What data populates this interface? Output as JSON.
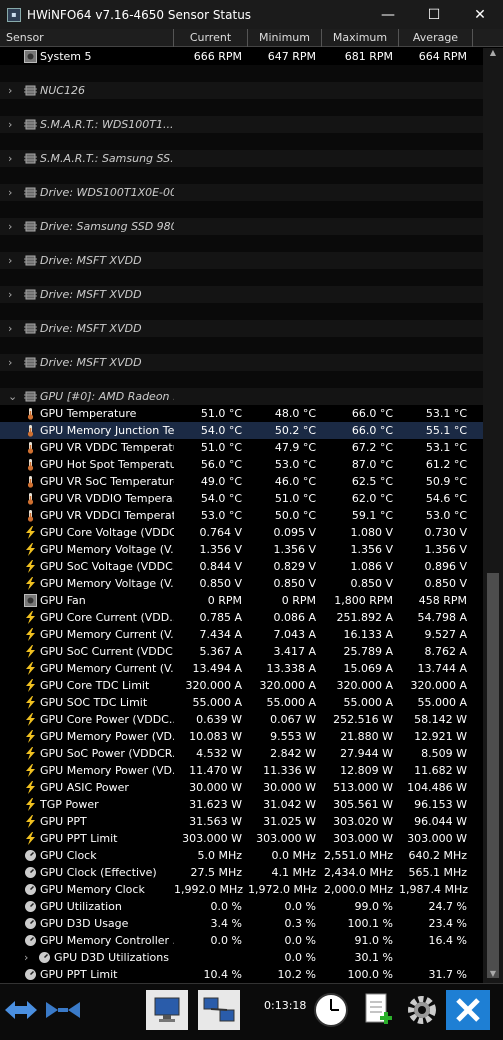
{
  "window": {
    "title": "HWiNFO64 v7.16-4650 Sensor Status",
    "min": "—",
    "max": "☐",
    "close": "✕"
  },
  "columns": [
    "Sensor",
    "Current",
    "Minimum",
    "Maximum",
    "Average"
  ],
  "rows": [
    {
      "type": "sensor",
      "icon": "fan",
      "name": "System 5",
      "cur": "666 RPM",
      "min": "647 RPM",
      "max": "681 RPM",
      "avg": "664 RPM"
    },
    {
      "type": "spacer"
    },
    {
      "type": "group",
      "name": "NUC126"
    },
    {
      "type": "spacer"
    },
    {
      "type": "group",
      "name": "S.M.A.R.T.: WDS100T1..."
    },
    {
      "type": "spacer"
    },
    {
      "type": "group",
      "name": "S.M.A.R.T.: Samsung SS..."
    },
    {
      "type": "spacer"
    },
    {
      "type": "group",
      "name": "Drive: WDS100T1X0E-00..."
    },
    {
      "type": "spacer"
    },
    {
      "type": "group",
      "name": "Drive: Samsung SSD 980..."
    },
    {
      "type": "spacer"
    },
    {
      "type": "group",
      "name": "Drive: MSFT XVDD"
    },
    {
      "type": "spacer"
    },
    {
      "type": "group",
      "name": "Drive: MSFT XVDD"
    },
    {
      "type": "spacer"
    },
    {
      "type": "group",
      "name": "Drive: MSFT XVDD"
    },
    {
      "type": "spacer"
    },
    {
      "type": "group",
      "name": "Drive: MSFT XVDD"
    },
    {
      "type": "spacer"
    },
    {
      "type": "group",
      "name": "GPU [#0]: AMD Radeon ...",
      "open": true
    },
    {
      "type": "sensor",
      "icon": "temp",
      "name": "GPU Temperature",
      "cur": "51.0 °C",
      "min": "48.0 °C",
      "max": "66.0 °C",
      "avg": "53.1 °C"
    },
    {
      "type": "sensor",
      "icon": "temp",
      "name": "GPU Memory Junction Te...",
      "cur": "54.0 °C",
      "min": "50.2 °C",
      "max": "66.0 °C",
      "avg": "55.1 °C",
      "selected": true
    },
    {
      "type": "sensor",
      "icon": "temp",
      "name": "GPU VR VDDC Temperature",
      "cur": "51.0 °C",
      "min": "47.9 °C",
      "max": "67.2 °C",
      "avg": "53.1 °C"
    },
    {
      "type": "sensor",
      "icon": "temp",
      "name": "GPU Hot Spot Temperature",
      "cur": "56.0 °C",
      "min": "53.0 °C",
      "max": "87.0 °C",
      "avg": "61.2 °C"
    },
    {
      "type": "sensor",
      "icon": "temp",
      "name": "GPU VR SoC Temperature",
      "cur": "49.0 °C",
      "min": "46.0 °C",
      "max": "62.5 °C",
      "avg": "50.9 °C"
    },
    {
      "type": "sensor",
      "icon": "temp",
      "name": "GPU VR VDDIO Tempera...",
      "cur": "54.0 °C",
      "min": "51.0 °C",
      "max": "62.0 °C",
      "avg": "54.6 °C"
    },
    {
      "type": "sensor",
      "icon": "temp",
      "name": "GPU VR VDDCI Temperat...",
      "cur": "53.0 °C",
      "min": "50.0 °C",
      "max": "59.1 °C",
      "avg": "53.0 °C"
    },
    {
      "type": "sensor",
      "icon": "bolt",
      "name": "GPU Core Voltage (VDDC...",
      "cur": "0.764 V",
      "min": "0.095 V",
      "max": "1.080 V",
      "avg": "0.730 V"
    },
    {
      "type": "sensor",
      "icon": "bolt",
      "name": "GPU Memory Voltage (V...",
      "cur": "1.356 V",
      "min": "1.356 V",
      "max": "1.356 V",
      "avg": "1.356 V"
    },
    {
      "type": "sensor",
      "icon": "bolt",
      "name": "GPU SoC Voltage (VDDC...",
      "cur": "0.844 V",
      "min": "0.829 V",
      "max": "1.086 V",
      "avg": "0.896 V"
    },
    {
      "type": "sensor",
      "icon": "bolt",
      "name": "GPU Memory Voltage (V...",
      "cur": "0.850 V",
      "min": "0.850 V",
      "max": "0.850 V",
      "avg": "0.850 V"
    },
    {
      "type": "sensor",
      "icon": "fan",
      "name": "GPU Fan",
      "cur": "0 RPM",
      "min": "0 RPM",
      "max": "1,800 RPM",
      "avg": "458 RPM"
    },
    {
      "type": "sensor",
      "icon": "bolt",
      "name": "GPU Core Current (VDD...",
      "cur": "0.785 A",
      "min": "0.086 A",
      "max": "251.892 A",
      "avg": "54.798 A"
    },
    {
      "type": "sensor",
      "icon": "bolt",
      "name": "GPU Memory Current (V...",
      "cur": "7.434 A",
      "min": "7.043 A",
      "max": "16.133 A",
      "avg": "9.527 A"
    },
    {
      "type": "sensor",
      "icon": "bolt",
      "name": "GPU SoC Current (VDDC...",
      "cur": "5.367 A",
      "min": "3.417 A",
      "max": "25.789 A",
      "avg": "8.762 A"
    },
    {
      "type": "sensor",
      "icon": "bolt",
      "name": "GPU Memory Current (V...",
      "cur": "13.494 A",
      "min": "13.338 A",
      "max": "15.069 A",
      "avg": "13.744 A"
    },
    {
      "type": "sensor",
      "icon": "bolt",
      "name": "GPU Core TDC Limit",
      "cur": "320.000 A",
      "min": "320.000 A",
      "max": "320.000 A",
      "avg": "320.000 A"
    },
    {
      "type": "sensor",
      "icon": "bolt",
      "name": "GPU SOC TDC Limit",
      "cur": "55.000 A",
      "min": "55.000 A",
      "max": "55.000 A",
      "avg": "55.000 A"
    },
    {
      "type": "sensor",
      "icon": "bolt",
      "name": "GPU Core Power (VDDC...",
      "cur": "0.639 W",
      "min": "0.067 W",
      "max": "252.516 W",
      "avg": "58.142 W"
    },
    {
      "type": "sensor",
      "icon": "bolt",
      "name": "GPU Memory Power (VD...",
      "cur": "10.083 W",
      "min": "9.553 W",
      "max": "21.880 W",
      "avg": "12.921 W"
    },
    {
      "type": "sensor",
      "icon": "bolt",
      "name": "GPU SoC Power (VDDCR...",
      "cur": "4.532 W",
      "min": "2.842 W",
      "max": "27.944 W",
      "avg": "8.509 W"
    },
    {
      "type": "sensor",
      "icon": "bolt",
      "name": "GPU Memory Power (VD...",
      "cur": "11.470 W",
      "min": "11.336 W",
      "max": "12.809 W",
      "avg": "11.682 W"
    },
    {
      "type": "sensor",
      "icon": "bolt",
      "name": "GPU ASIC Power",
      "cur": "30.000 W",
      "min": "30.000 W",
      "max": "513.000 W",
      "avg": "104.486 W"
    },
    {
      "type": "sensor",
      "icon": "bolt",
      "name": "TGP Power",
      "cur": "31.623 W",
      "min": "31.042 W",
      "max": "305.561 W",
      "avg": "96.153 W"
    },
    {
      "type": "sensor",
      "icon": "bolt",
      "name": "GPU PPT",
      "cur": "31.563 W",
      "min": "31.025 W",
      "max": "303.020 W",
      "avg": "96.044 W"
    },
    {
      "type": "sensor",
      "icon": "bolt",
      "name": "GPU PPT Limit",
      "cur": "303.000 W",
      "min": "303.000 W",
      "max": "303.000 W",
      "avg": "303.000 W"
    },
    {
      "type": "sensor",
      "icon": "gauge",
      "name": "GPU Clock",
      "cur": "5.0 MHz",
      "min": "0.0 MHz",
      "max": "2,551.0 MHz",
      "avg": "640.2 MHz"
    },
    {
      "type": "sensor",
      "icon": "gauge",
      "name": "GPU Clock (Effective)",
      "cur": "27.5 MHz",
      "min": "4.1 MHz",
      "max": "2,434.0 MHz",
      "avg": "565.1 MHz"
    },
    {
      "type": "sensor",
      "icon": "gauge",
      "name": "GPU Memory Clock",
      "cur": "1,992.0 MHz",
      "min": "1,972.0 MHz",
      "max": "2,000.0 MHz",
      "avg": "1,987.4 MHz"
    },
    {
      "type": "sensor",
      "icon": "gauge",
      "name": "GPU Utilization",
      "cur": "0.0 %",
      "min": "0.0 %",
      "max": "99.0 %",
      "avg": "24.7 %"
    },
    {
      "type": "sensor",
      "icon": "gauge",
      "name": "GPU D3D Usage",
      "cur": "3.4 %",
      "min": "0.3 %",
      "max": "100.1 %",
      "avg": "23.4 %"
    },
    {
      "type": "sensor",
      "icon": "gauge",
      "name": "GPU Memory Controller ...",
      "cur": "0.0 %",
      "min": "0.0 %",
      "max": "91.0 %",
      "avg": "16.4 %"
    },
    {
      "type": "subgroup",
      "icon": "gauge",
      "name": "GPU D3D Utilizations",
      "cur": "",
      "min": "0.0 %",
      "max": "30.1 %",
      "avg": ""
    },
    {
      "type": "sensor",
      "icon": "gauge",
      "name": "GPU PPT Limit",
      "cur": "10.4 %",
      "min": "10.2 %",
      "max": "100.0 %",
      "avg": "31.7 %"
    }
  ],
  "toolbar": {
    "elapsed": "0:13:18"
  },
  "colors": {
    "selected_row": "#1b2a44",
    "temp_icon": "#d08040",
    "bolt_icon": "#f0c020"
  }
}
